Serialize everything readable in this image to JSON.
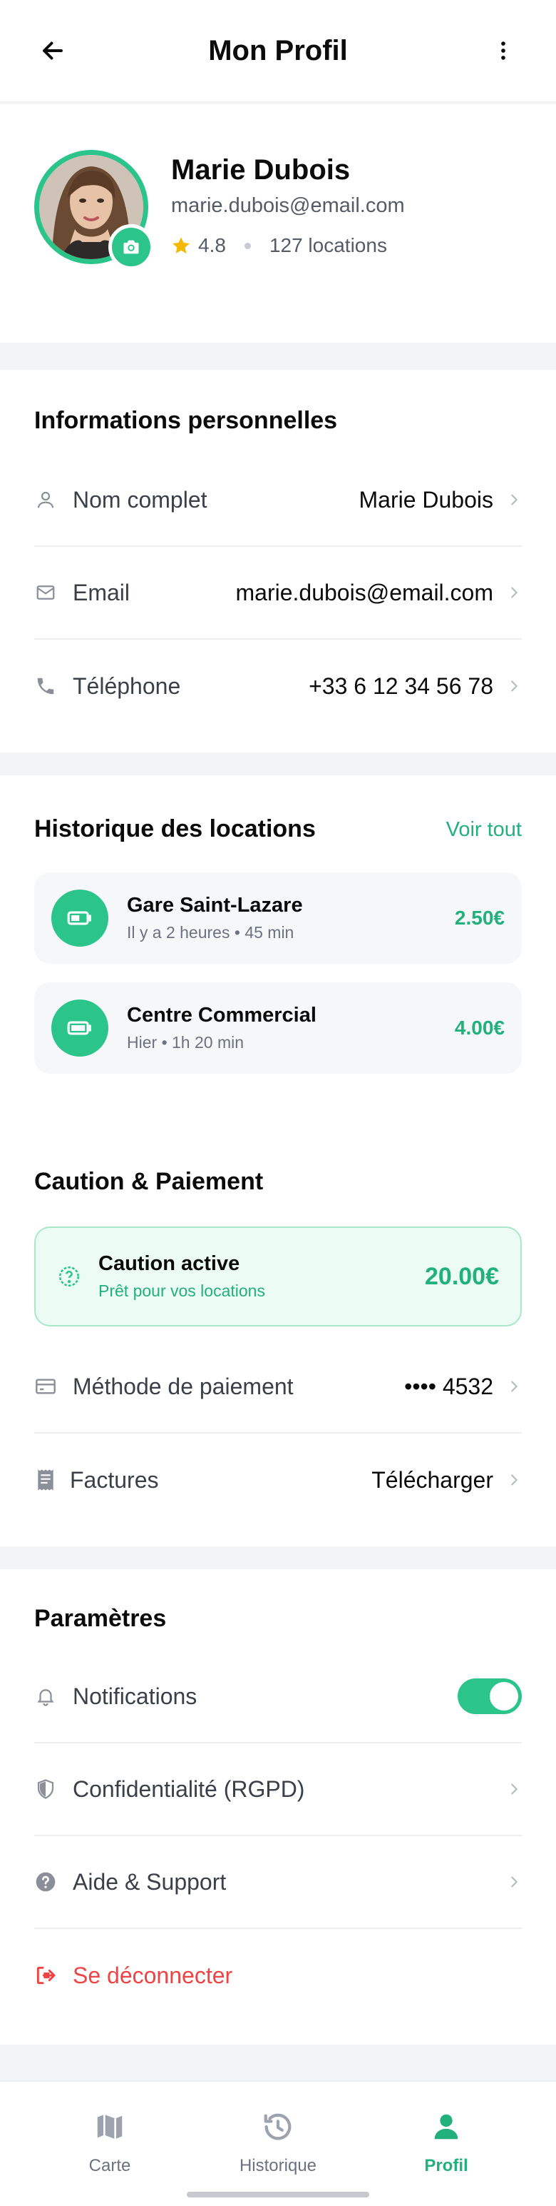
{
  "header": {
    "title": "Mon Profil",
    "back_icon": "arrow-left-icon",
    "menu_icon": "more-vertical-icon"
  },
  "profile": {
    "name": "Marie Dubois",
    "email": "marie.dubois@email.com",
    "rating": "4.8",
    "rentals_count": "127 locations"
  },
  "personal_info": {
    "title": "Informations personnelles",
    "rows": [
      {
        "label": "Nom complet",
        "value": "Marie Dubois",
        "icon": "user-icon"
      },
      {
        "label": "Email",
        "value": "marie.dubois@email.com",
        "icon": "mail-icon"
      },
      {
        "label": "Téléphone",
        "value": "+33 6 12 34 56 78",
        "icon": "phone-icon"
      }
    ]
  },
  "history": {
    "title": "Historique des locations",
    "see_all": "Voir tout",
    "items": [
      {
        "name": "Gare Saint-Lazare",
        "when": "Il y a 2 heures",
        "duration": "45 min",
        "price": "2.50€"
      },
      {
        "name": "Centre Commercial",
        "when": "Hier",
        "duration": "1h 20 min",
        "price": "4.00€"
      }
    ]
  },
  "payment": {
    "title": "Caution & Paiement",
    "deposit": {
      "title": "Caution active",
      "subtitle": "Prêt pour vos locations",
      "amount": "20.00€"
    },
    "rows": [
      {
        "label": "Méthode de paiement",
        "value": "•••• 4532",
        "icon": "credit-card-icon"
      },
      {
        "label": "Factures",
        "value": "Télécharger",
        "icon": "receipt-icon"
      }
    ]
  },
  "settings": {
    "title": "Paramètres",
    "notifications_label": "Notifications",
    "notifications_enabled": true,
    "privacy_label": "Confidentialité (RGPD)",
    "support_label": "Aide & Support",
    "logout_label": "Se déconnecter"
  },
  "nav": {
    "items": [
      {
        "label": "Carte",
        "icon": "map-icon",
        "active": false
      },
      {
        "label": "Historique",
        "icon": "history-icon",
        "active": false
      },
      {
        "label": "Profil",
        "icon": "user-icon",
        "active": true
      }
    ]
  },
  "colors": {
    "accent": "#2bc48a",
    "accent_text": "#22b07d",
    "danger": "#ef4444"
  }
}
